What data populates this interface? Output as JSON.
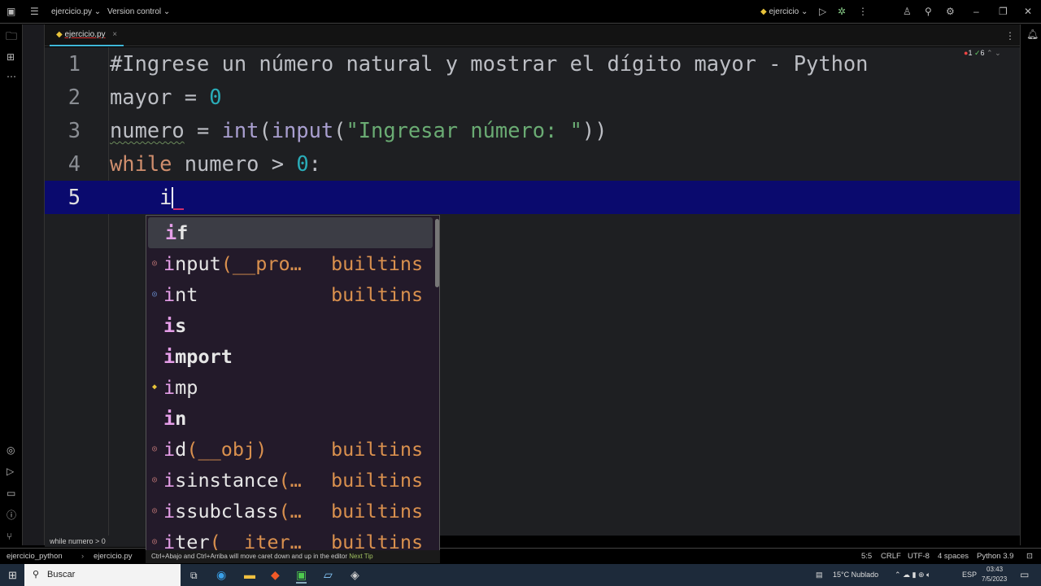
{
  "titlebar": {
    "project": "ejercicio.py",
    "vcs": "Version control",
    "run_config": "ejercicio"
  },
  "tab": {
    "label": "ejercicio.py"
  },
  "inspections": {
    "errors": "1",
    "warnings": "6"
  },
  "code": {
    "lines": [
      "1",
      "2",
      "3",
      "4",
      "5"
    ],
    "l1": "#Ingrese un número natural y mostrar el dígito mayor - Python",
    "l2a": "mayor = ",
    "l2b": "0",
    "l3a": "numero",
    " l3b": " = ",
    "l3c": "int",
    "l3d": "(",
    "l3e": "input",
    "l3f": "(",
    "l3g": "\"Ingresar número: \"",
    "l3h": "))",
    "l4a": "while",
    "l4b": " numero > ",
    "l4c": "0",
    "l4d": ":",
    "l5": "    i"
  },
  "completion": {
    "items": [
      {
        "m": "i",
        "rest": "f",
        "params": "",
        "source": ""
      },
      {
        "m": "i",
        "rest": "nput",
        "params": "(__pro…",
        "source": "builtins"
      },
      {
        "m": "i",
        "rest": "nt",
        "params": "",
        "source": "builtins"
      },
      {
        "m": "i",
        "rest": "s",
        "params": "",
        "source": ""
      },
      {
        "m": "i",
        "rest": "mport",
        "params": "",
        "source": ""
      },
      {
        "m": "i",
        "rest": "mp",
        "params": "",
        "source": ""
      },
      {
        "m": "i",
        "rest": "n",
        "params": "",
        "source": ""
      },
      {
        "m": "i",
        "rest": "d",
        "params": "(__obj)",
        "source": "builtins"
      },
      {
        "m": "i",
        "rest": "sinstance",
        "params": "(…",
        "source": "builtins"
      },
      {
        "m": "i",
        "rest": "ssubclass",
        "params": "(…",
        "source": "builtins"
      },
      {
        "m": "i",
        "rest": "ter",
        "params": "(__iter…",
        "source": "builtins"
      }
    ],
    "tip": "Ctrl+Abajo and Ctrl+Arriba will move caret down and up in the editor",
    "next_tip": "Next Tip"
  },
  "breadcrumb": "while numero > 0",
  "status": {
    "project": "ejercicio_python",
    "file": "ejercicio.py",
    "pos": "5:5",
    "eol": "CRLF",
    "enc": "UTF-8",
    "indent": "4 spaces",
    "interp": "Python 3.9"
  },
  "taskbar": {
    "search": "Buscar",
    "weather": "15°C  Nublado",
    "lang": "ESP",
    "time": "03:43",
    "date": "7/5/2023"
  }
}
